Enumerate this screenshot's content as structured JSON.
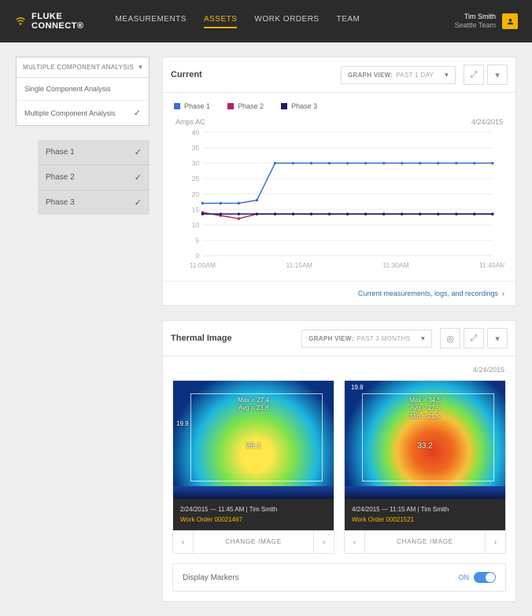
{
  "brand": {
    "line1": "FLUKE",
    "line2": "CONNECT",
    "mark": "®"
  },
  "nav": {
    "items": [
      "MEASUREMENTS",
      "ASSETS",
      "WORK ORDERS",
      "TEAM"
    ],
    "active_index": 1
  },
  "user": {
    "name": "Tim Smith",
    "team": "Seattle Team"
  },
  "sidebar": {
    "dropdown_title": "MULTIPLE COMPONENT ANALYSIS",
    "options": [
      {
        "label": "Single Component Analysis",
        "selected": false
      },
      {
        "label": "Multiple Component Analysis",
        "selected": true
      }
    ],
    "phases": [
      {
        "label": "Phase 1",
        "selected": true
      },
      {
        "label": "Phase 2",
        "selected": true
      },
      {
        "label": "Phase 3",
        "selected": true
      }
    ]
  },
  "current_panel": {
    "title": "Current",
    "graph_view_label": "GRAPH VIEW:",
    "graph_view_value": "PAST 1 DAY",
    "legend": [
      {
        "label": "Phase 1",
        "color": "#3b6fd1"
      },
      {
        "label": "Phase 2",
        "color": "#b0206b"
      },
      {
        "label": "Phase 3",
        "color": "#1a1a6a"
      }
    ],
    "y_title": "Amps AC",
    "date": "4/24/2015",
    "footer_link": "Current measurements, logs, and recordings"
  },
  "chart_data": {
    "type": "line",
    "xlabel": "",
    "ylabel": "Amps AC",
    "ylim": [
      0,
      40
    ],
    "yticks": [
      0,
      5,
      10,
      15,
      20,
      25,
      30,
      35,
      40
    ],
    "xticks": [
      "11:00AM",
      "11:15AM",
      "11:30AM",
      "11:45AM"
    ],
    "x": [
      0,
      1,
      2,
      3,
      4,
      5,
      6,
      7,
      8,
      9,
      10,
      11,
      12,
      13,
      14,
      15,
      16
    ],
    "series": [
      {
        "name": "Phase 1",
        "color": "#3b6fd1",
        "values": [
          17,
          17,
          17,
          18,
          30,
          30,
          30,
          30,
          30,
          30,
          30,
          30,
          30,
          30,
          30,
          30,
          30
        ]
      },
      {
        "name": "Phase 2",
        "color": "#b0206b",
        "values": [
          14,
          13,
          12,
          13.5,
          13.5,
          13.5,
          13.5,
          13.5,
          13.5,
          13.5,
          13.5,
          13.5,
          13.5,
          13.5,
          13.5,
          13.5,
          13.5
        ]
      },
      {
        "name": "Phase 3",
        "color": "#1a1a6a",
        "values": [
          13.5,
          13.5,
          13.5,
          13.5,
          13.5,
          13.5,
          13.5,
          13.5,
          13.5,
          13.5,
          13.5,
          13.5,
          13.5,
          13.5,
          13.5,
          13.5,
          13.5
        ]
      }
    ]
  },
  "thermal_panel": {
    "title": "Thermal Image",
    "graph_view_label": "GRAPH VIEW:",
    "graph_view_value": "PAST 3 MONTHS",
    "date": "4/24/2015",
    "cards": [
      {
        "corner": "",
        "side": "19.9",
        "overlay": "Max = 27.4\nAvg = 23.8",
        "center": "26.1",
        "meta_line": "2/24/2015 — 11:45 AM | Tim Smith",
        "work_order": "Work Order 00021467",
        "change_label": "CHANGE IMAGE"
      },
      {
        "corner": "19.8",
        "side": "",
        "overlay": "Max = 34.5\nAvg = 27.5\nMin = 21.5",
        "center": "33.2",
        "meta_line": "4/24/2015 — 11:15 AM | Tim Smith",
        "work_order": "Work Order 00021521",
        "change_label": "CHANGE IMAGE"
      }
    ],
    "markers_label": "Display Markers",
    "markers_state": "ON"
  }
}
